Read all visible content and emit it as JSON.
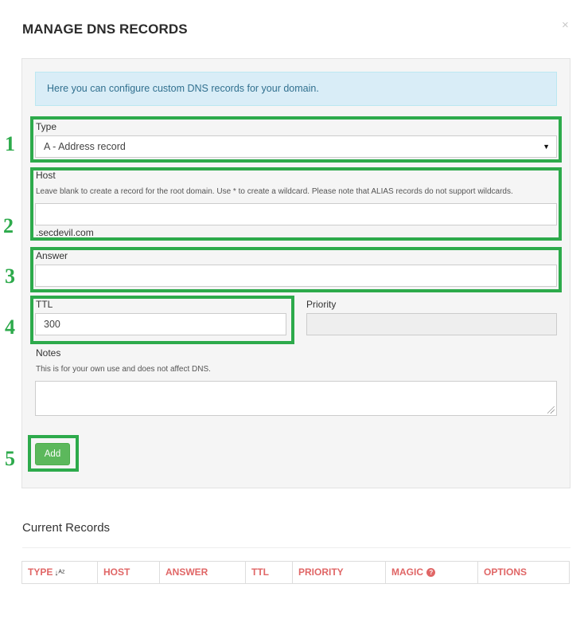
{
  "modal": {
    "title": "MANAGE DNS RECORDS",
    "close_glyph": "×"
  },
  "form": {
    "info_text": "Here you can configure custom DNS records for your domain.",
    "type": {
      "label": "Type",
      "value": "A - Address record",
      "caret_icon": "caret-down-icon"
    },
    "host": {
      "label": "Host",
      "help": "Leave blank to create a record for the root domain. Use * to create a wildcard. Please note that ALIAS records do not support wildcards.",
      "value": "",
      "suffix": ".secdevil.com"
    },
    "answer": {
      "label": "Answer",
      "value": ""
    },
    "ttl": {
      "label": "TTL",
      "value": "300"
    },
    "priority": {
      "label": "Priority",
      "value": ""
    },
    "notes": {
      "label": "Notes",
      "help": "This is for your own use and does not affect DNS.",
      "value": ""
    },
    "add_label": "Add"
  },
  "annotations": [
    "1",
    "2",
    "3",
    "4",
    "5"
  ],
  "records": {
    "title": "Current Records",
    "columns": [
      "TYPE",
      "HOST",
      "ANSWER",
      "TTL",
      "PRIORITY",
      "MAGIC",
      "OPTIONS"
    ],
    "sort_icon": "sort-alpha-asc-icon",
    "magic_icon": "question-circle-icon"
  },
  "colors": {
    "annotation_green": "#2daa4b",
    "button_green": "#5cb85c",
    "info_background": "#d9edf7",
    "info_text": "#31708f",
    "header_red": "#e06666"
  }
}
